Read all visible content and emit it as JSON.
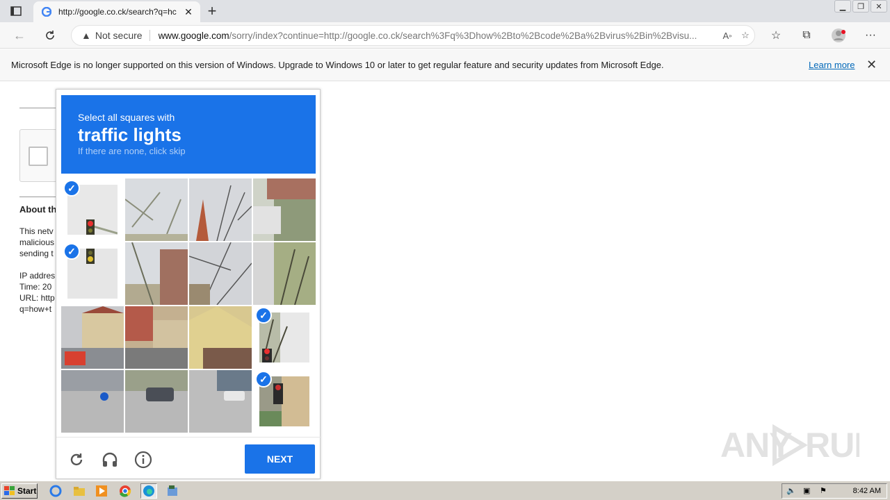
{
  "browser": {
    "tab_title": "http://google.co.ck/search?q=hc",
    "not_secure": "Not secure",
    "url_host": "www.google.com",
    "url_rest": "/sorry/index?continue=http://google.co.ck/search%3Fq%3Dhow%2Bto%2Bcode%2Ba%2Bvirus%2Bin%2Bvisu..."
  },
  "banner": {
    "message": "Microsoft Edge is no longer supported on this version of Windows. Upgrade to Windows 10 or later to get regular feature and security updates from Microsoft Edge.",
    "learn_more": "Learn more"
  },
  "background_page": {
    "about_heading": "About th",
    "line1": "This netv",
    "line2": "malicious",
    "line3": "sending t",
    "ip": "IP addres",
    "time": "Time: 20",
    "url": "URL: http",
    "q": "q=how+t"
  },
  "captcha": {
    "instruction": "Select all squares with",
    "target": "traffic lights",
    "hint": "If there are none, click skip",
    "next_label": "NEXT",
    "selected_tiles": [
      {
        "row": 1,
        "col": 1
      },
      {
        "row": 2,
        "col": 1
      },
      {
        "row": 3,
        "col": 4
      },
      {
        "row": 4,
        "col": 4
      }
    ]
  },
  "watermark": "ANY RUN",
  "taskbar": {
    "start_label": "Start",
    "clock": "8:42 AM"
  }
}
